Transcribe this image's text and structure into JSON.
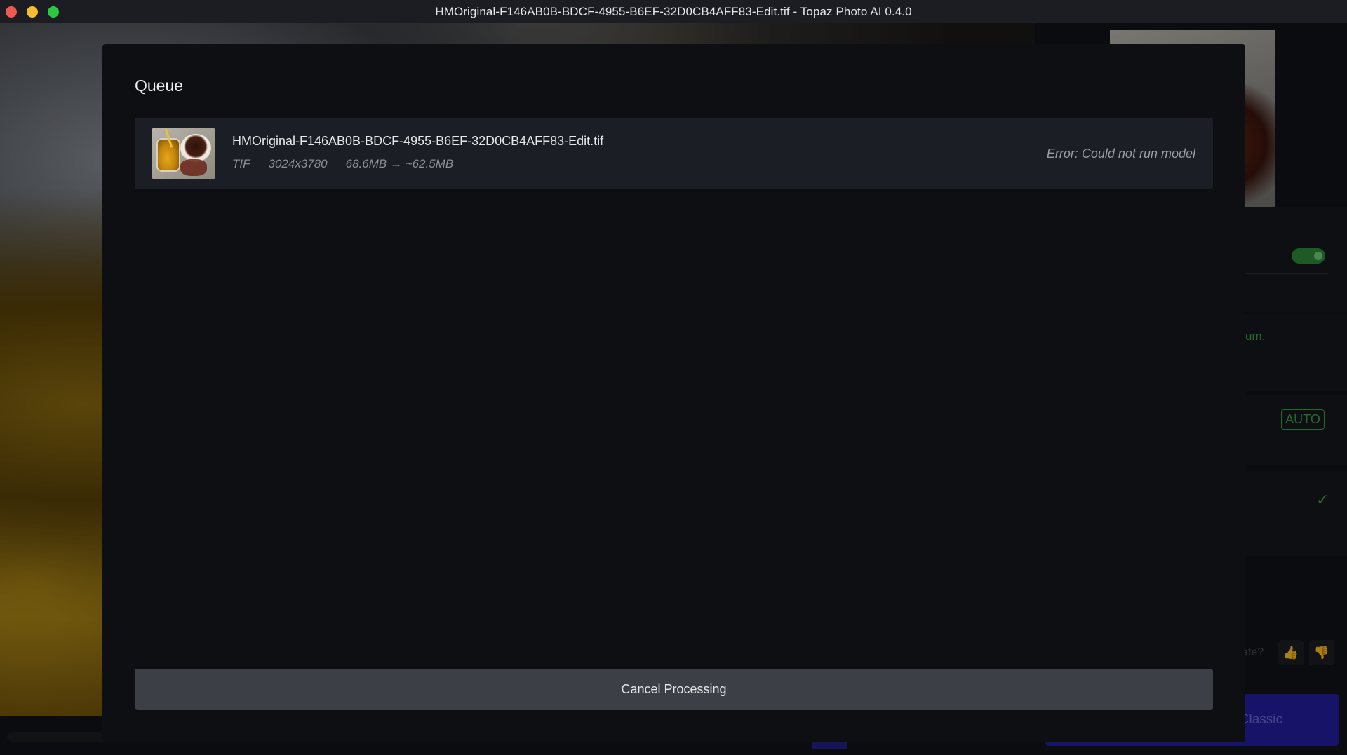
{
  "window": {
    "title": "HMOriginal-F146AB0B-BDCF-4955-B6EF-32D0CB4AFF83-Edit.tif - Topaz Photo AI 0.4.0"
  },
  "background_panel": {
    "green_fragment": "um.",
    "auto_badge": "AUTO",
    "rate_fragment": "ate?",
    "classic_label": "Classic"
  },
  "queue": {
    "title": "Queue",
    "items": [
      {
        "filename": "HMOriginal-F146AB0B-BDCF-4955-B6EF-32D0CB4AFF83-Edit.tif",
        "format": "TIF",
        "dimensions": "3024x3780",
        "size": "68.6MB → ~62.5MB",
        "status": "Error: Could not run model"
      }
    ],
    "cancel_label": "Cancel Processing"
  },
  "colors": {
    "accent_green": "#3aa14a",
    "accent_blue": "#221ea0",
    "modal_bg": "#0d0f13",
    "item_bg": "#1b1e24",
    "button_bg": "#3c3f45"
  }
}
